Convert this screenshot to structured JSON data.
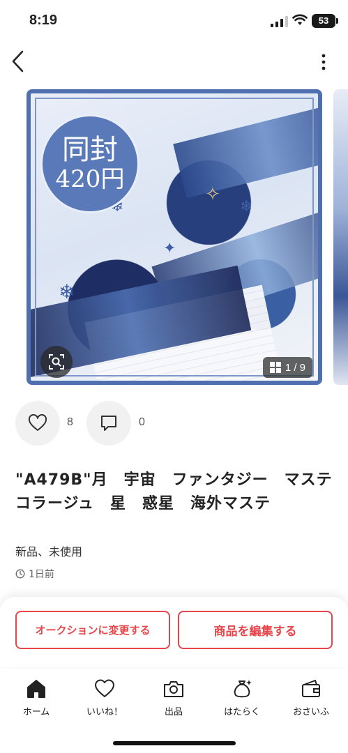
{
  "status_bar": {
    "time": "8:19",
    "battery": "53"
  },
  "image": {
    "badge_line1": "同封",
    "badge_line2": "420円",
    "counter": "1 / 9"
  },
  "actions": {
    "like_count": "8",
    "comment_count": "0"
  },
  "item": {
    "title": "\"A479B\"月　宇宙　ファンタジー　マステ　コラージュ　星　惑星　海外マステ",
    "condition": "新品、未使用",
    "posted": "1日前"
  },
  "buttons": {
    "auction": "オークションに変更する",
    "edit": "商品を編集する"
  },
  "tabs": [
    {
      "label": "ホーム",
      "icon": "home-icon"
    },
    {
      "label": "いいね！",
      "icon": "heart-icon"
    },
    {
      "label": "出品",
      "icon": "camera-icon"
    },
    {
      "label": "はたらく",
      "icon": "money-bag-icon"
    },
    {
      "label": "おさいふ",
      "icon": "wallet-icon"
    }
  ],
  "colors": {
    "accent": "#e8444a",
    "frame": "#4f6fb0"
  }
}
